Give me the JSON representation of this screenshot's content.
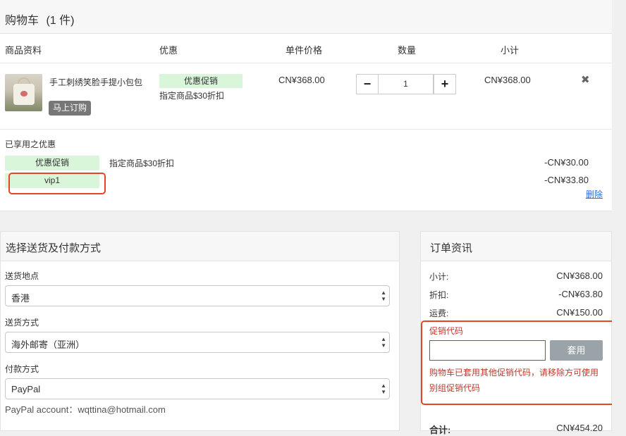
{
  "cart": {
    "title": "购物车",
    "count": "(1 件)",
    "columns": {
      "product": "商品资料",
      "discount": "优惠",
      "unit_price": "单件价格",
      "quantity": "数量",
      "subtotal": "小计"
    },
    "item": {
      "name": "手工刺绣笑脸手提小包包",
      "buy_now": "马上订购",
      "promo_tag": "优惠促销",
      "promo_desc": "指定商品$30折扣",
      "unit_price": "CN¥368.00",
      "quantity": "1",
      "subtotal": "CN¥368.00",
      "minus": "−",
      "plus": "+",
      "remove": "✖"
    },
    "applied": {
      "title": "已享用之优惠",
      "rows": [
        {
          "tag": "优惠促销",
          "desc": "指定商品$30折扣",
          "amount": "-CN¥30.00"
        },
        {
          "tag": "vip1",
          "desc": "",
          "amount": "-CN¥33.80",
          "action": "删除"
        }
      ]
    }
  },
  "shipping": {
    "title": "选择送货及付款方式",
    "location_label": "送货地点",
    "location_value": "香港",
    "method_label": "送货方式",
    "method_value": "海外邮寄（亚洲）",
    "payment_label": "付款方式",
    "payment_value": "PayPal",
    "paypal_note": "PayPal account：wqttina@hotmail.com"
  },
  "order": {
    "title": "订单资讯",
    "subtotal_label": "小计:",
    "subtotal_value": "CN¥368.00",
    "discount_label": "折扣:",
    "discount_value": "-CN¥63.80",
    "shipping_label": "运费:",
    "shipping_value": "CN¥150.00",
    "promo_label": "促销代码",
    "promo_placeholder": "",
    "apply_label": "套用",
    "promo_error": "购物车已套用其他促销代码，请移除方可使用别组促销代码",
    "total_label": "合计:",
    "total_value": "CN¥454.20"
  },
  "colors": {
    "promo_tag_bg": "#d9f5da",
    "highlight_border": "#e4471f",
    "error_text": "#c0392b",
    "link": "#2a6fd6"
  }
}
